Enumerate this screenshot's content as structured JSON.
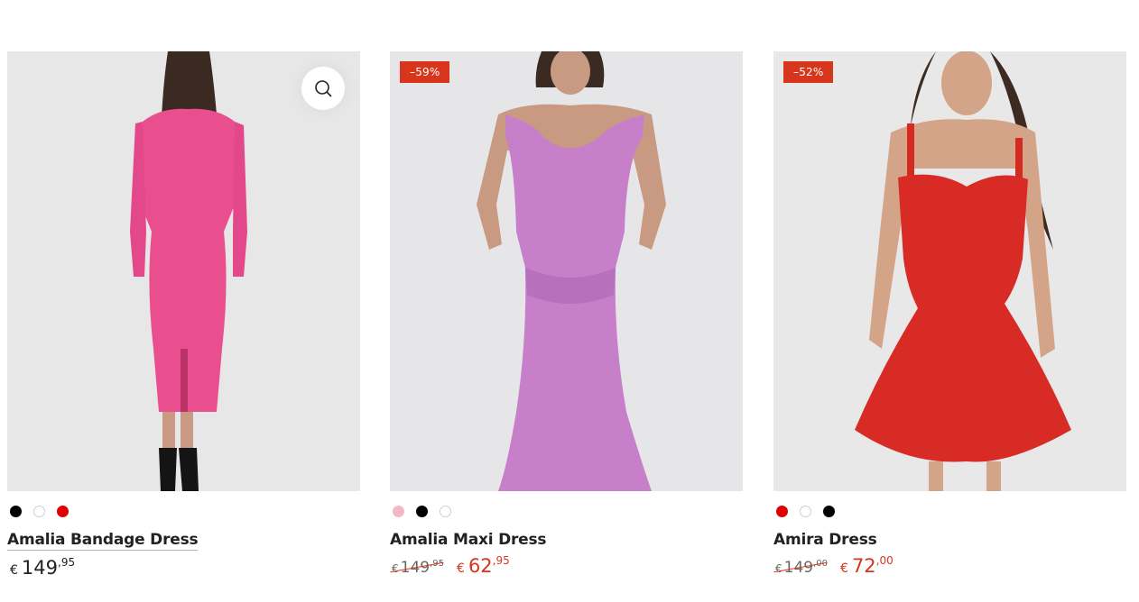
{
  "products": [
    {
      "name": "Amalia Bandage Dress",
      "badge": "",
      "colors": [
        "#000000",
        "#ffffff",
        "#e00000"
      ],
      "quick_view_icon": "search-icon",
      "price": {
        "currency": "€",
        "whole": "149",
        "cents": "95"
      },
      "sale_price": null
    },
    {
      "name": "Amalia Maxi Dress",
      "badge": "–59%",
      "colors": [
        "#f2b8c6",
        "#000000",
        "#ffffff"
      ],
      "price": {
        "currency": "€",
        "whole": "149",
        "cents": "95"
      },
      "sale_price": {
        "currency": "€",
        "whole": "62",
        "cents": "95"
      }
    },
    {
      "name": "Amira Dress",
      "badge": "–52%",
      "colors": [
        "#e00000",
        "#ffffff",
        "#000000"
      ],
      "price": {
        "currency": "€",
        "whole": "149",
        "cents": "00"
      },
      "sale_price": {
        "currency": "€",
        "whole": "72",
        "cents": "00"
      }
    }
  ],
  "theme": {
    "sale_color": "#d8361c",
    "image_bg": "#e6e6e7"
  }
}
